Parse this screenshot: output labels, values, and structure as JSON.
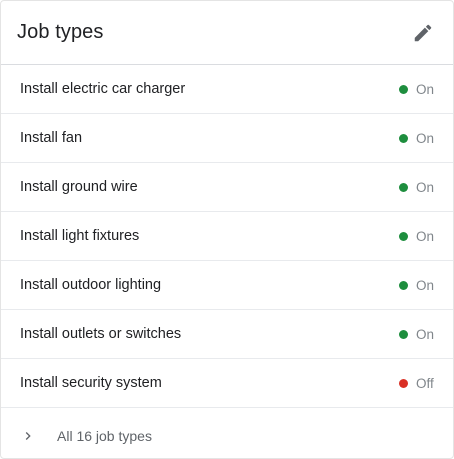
{
  "card": {
    "title": "Job types",
    "edit_icon": "pencil-icon"
  },
  "colors": {
    "on": "#1e8e3e",
    "off": "#d93025"
  },
  "job_types": [
    {
      "label": "Install electric car charger",
      "status": "On"
    },
    {
      "label": "Install fan",
      "status": "On"
    },
    {
      "label": "Install ground wire",
      "status": "On"
    },
    {
      "label": "Install light fixtures",
      "status": "On"
    },
    {
      "label": "Install outdoor lighting",
      "status": "On"
    },
    {
      "label": "Install outlets or switches",
      "status": "On"
    },
    {
      "label": "Install security system",
      "status": "Off"
    }
  ],
  "footer": {
    "label": "All 16 job types",
    "icon": "chevron-right-icon"
  }
}
